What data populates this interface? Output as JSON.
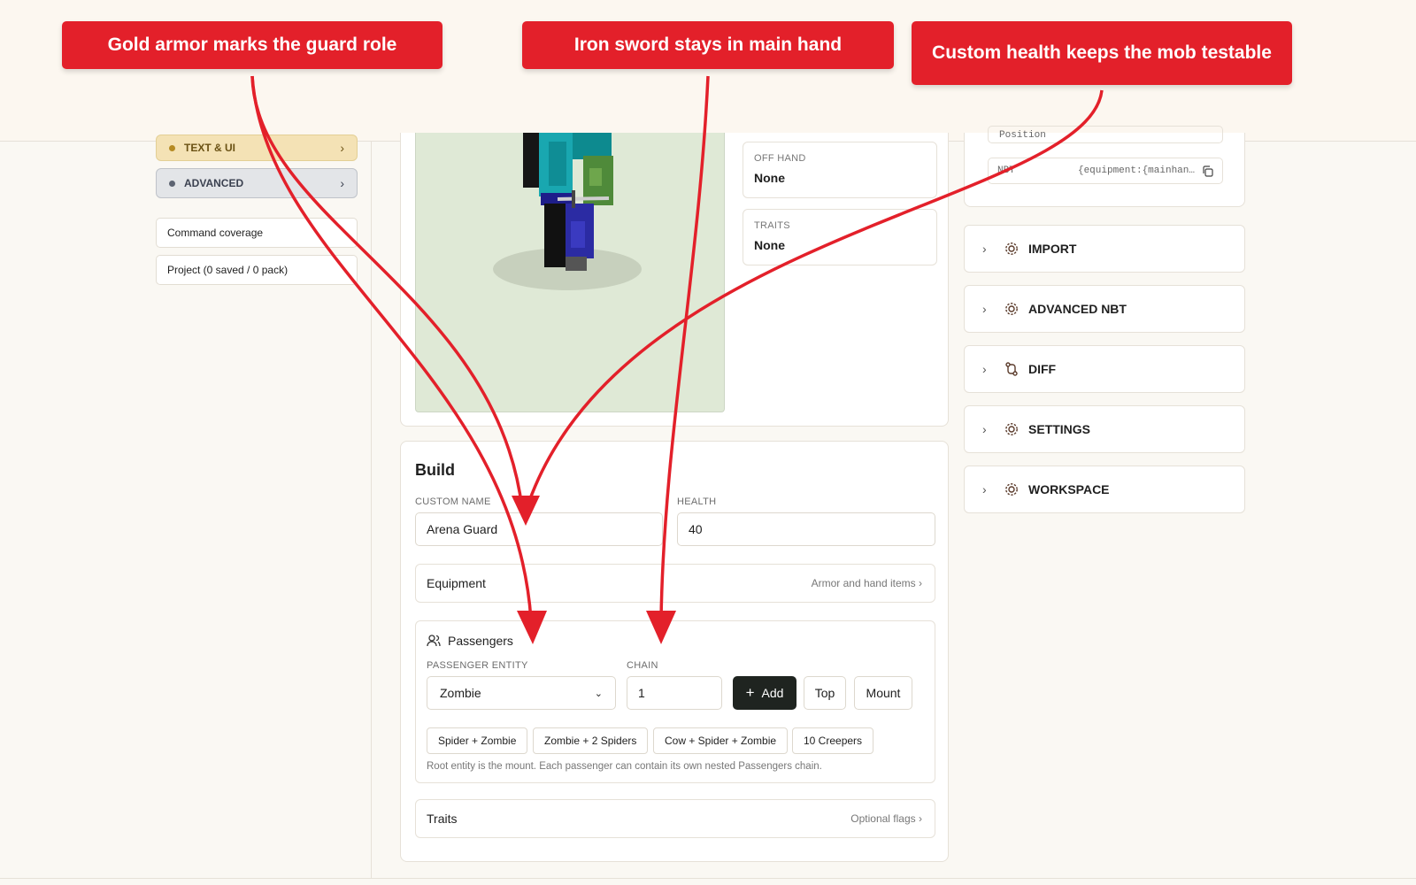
{
  "callouts": [
    "Gold armor marks the guard role",
    "Iron sword stays in main hand",
    "Custom health keeps the mob testable"
  ],
  "sidebar": {
    "text_ui": "TEXT & UI",
    "advanced": "ADVANCED",
    "coverage": "Command coverage",
    "project": "Project (0 saved / 0 pack)"
  },
  "preview": {
    "off_hand_label": "OFF HAND",
    "off_hand_value": "None",
    "traits_label": "TRAITS",
    "traits_value": "None"
  },
  "build": {
    "title": "Build",
    "custom_name_label": "CUSTOM NAME",
    "custom_name_value": "Arena Guard",
    "health_label": "HEALTH",
    "health_value": "40",
    "equipment_title": "Equipment",
    "equipment_hint": "Armor and hand items",
    "passengers": {
      "title": "Passengers",
      "entity_label": "PASSENGER ENTITY",
      "entity_value": "Zombie",
      "chain_label": "CHAIN",
      "chain_value": "1",
      "add": "Add",
      "top": "Top",
      "mount": "Mount",
      "presets": [
        "Spider + Zombie",
        "Zombie + 2 Spiders",
        "Cow + Spider + Zombie",
        "10 Creepers"
      ],
      "note": "Root entity is the mount. Each passenger can contain its own nested Passengers chain."
    },
    "traits_title": "Traits",
    "traits_hint": "Optional flags"
  },
  "right": {
    "nbt_row1": "Position",
    "nbt_row2_label": "NBT",
    "nbt_row2_value": "{equipment:{mainhan…",
    "sections": [
      "IMPORT",
      "ADVANCED NBT",
      "DIFF",
      "SETTINGS",
      "WORKSPACE"
    ]
  },
  "colors": {
    "callout": "#e3202a",
    "accent_dark": "#1f2420",
    "viewport_bg": "#dfe9d6"
  }
}
